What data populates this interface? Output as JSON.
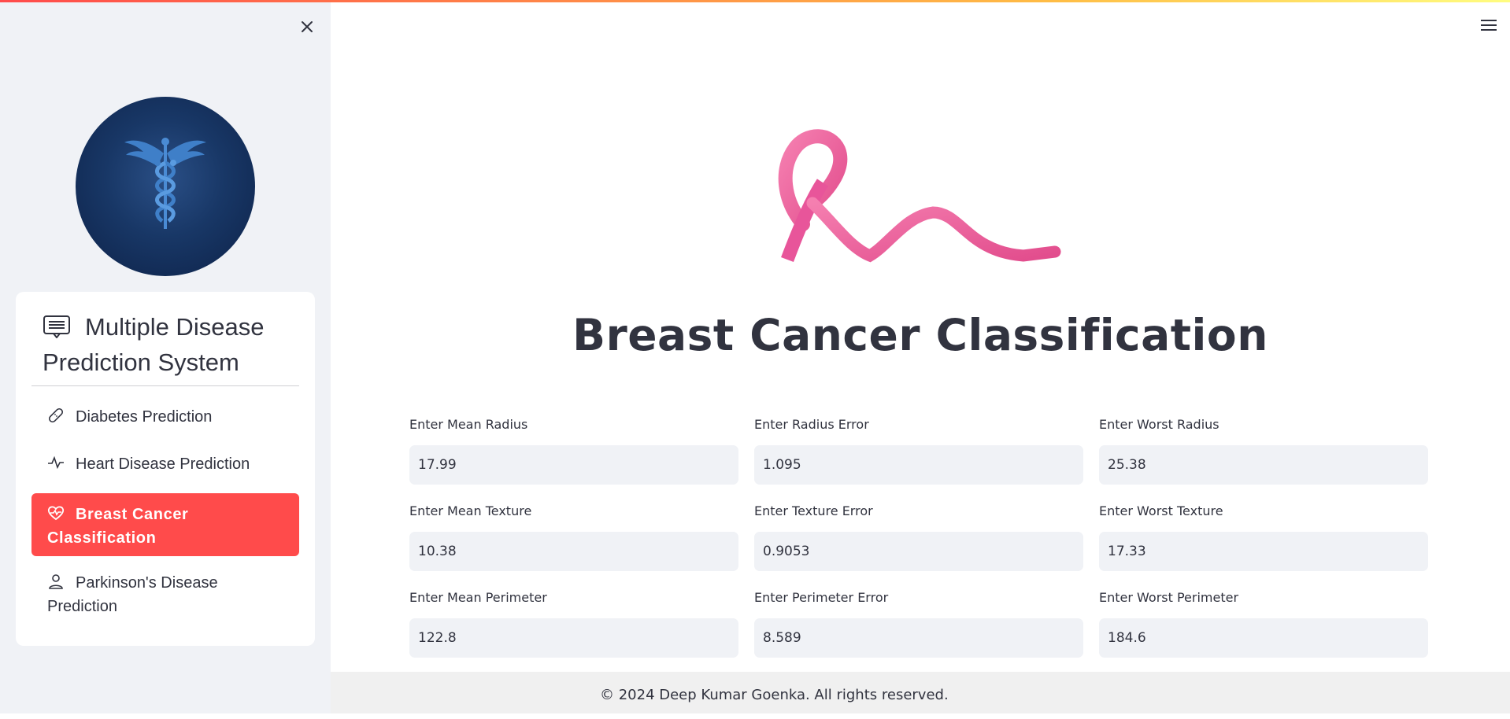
{
  "sidebar": {
    "title": "Multiple Disease Prediction System",
    "items": [
      {
        "label": "Diabetes Prediction",
        "icon": "bandage-icon"
      },
      {
        "label": "Heart Disease Prediction",
        "icon": "activity-icon"
      },
      {
        "label": "Breast Cancer Classification",
        "icon": "heart-pulse-icon",
        "active": true
      },
      {
        "label": "Parkinson's Disease Prediction",
        "icon": "person-icon"
      }
    ]
  },
  "main": {
    "title": "Breast Cancer Classification",
    "fields": [
      {
        "label": "Enter Mean Radius",
        "value": "17.99"
      },
      {
        "label": "Enter Radius Error",
        "value": "1.095"
      },
      {
        "label": "Enter Worst Radius",
        "value": "25.38"
      },
      {
        "label": "Enter Mean Texture",
        "value": "10.38"
      },
      {
        "label": "Enter Texture Error",
        "value": "0.9053"
      },
      {
        "label": "Enter Worst Texture",
        "value": "17.33"
      },
      {
        "label": "Enter Mean Perimeter",
        "value": "122.8"
      },
      {
        "label": "Enter Perimeter Error",
        "value": "8.589"
      },
      {
        "label": "Enter Worst Perimeter",
        "value": "184.6"
      }
    ]
  },
  "footer": {
    "text": "© 2024 Deep Kumar Goenka. All rights reserved."
  },
  "colors": {
    "accent": "#ff4b4b",
    "sidebar_bg": "#f0f2f6",
    "ribbon": "#f06aa0",
    "logo_bg": "#183766"
  }
}
